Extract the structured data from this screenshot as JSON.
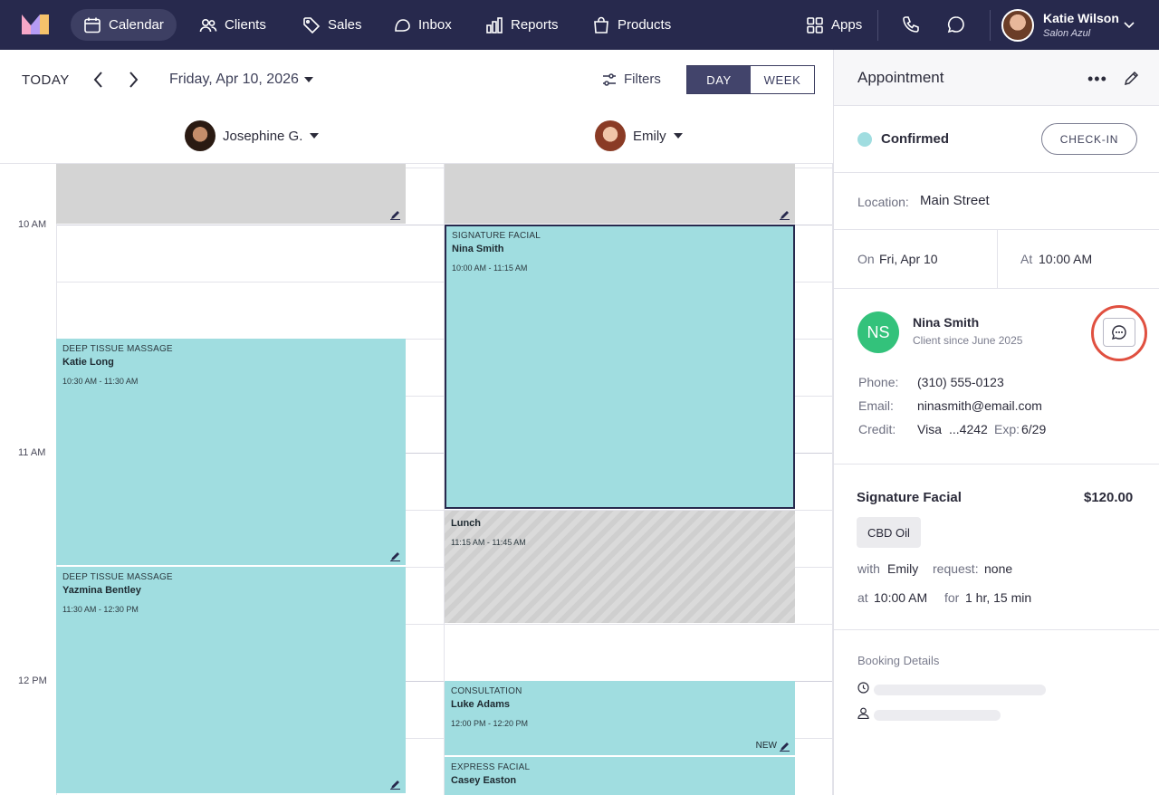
{
  "nav": {
    "items": [
      {
        "label": "Calendar",
        "icon": "calendar-icon",
        "active": true
      },
      {
        "label": "Clients",
        "icon": "users-icon"
      },
      {
        "label": "Sales",
        "icon": "tag-icon"
      },
      {
        "label": "Inbox",
        "icon": "inbox-icon"
      },
      {
        "label": "Reports",
        "icon": "bar-chart-icon"
      },
      {
        "label": "Products",
        "icon": "shopping-bag-icon"
      }
    ],
    "apps_label": "Apps",
    "user": {
      "name": "Katie Wilson",
      "org": "Salon Azul"
    }
  },
  "calendar": {
    "today_label": "TODAY",
    "date": "Friday, Apr 10, 2026",
    "filters_label": "Filters",
    "view": {
      "day": "DAY",
      "week": "WEEK",
      "selected": "day"
    },
    "staff": [
      {
        "name": "Josephine G."
      },
      {
        "name": "Emily"
      }
    ],
    "time_labels": [
      "10 AM",
      "11 AM",
      "12 PM"
    ],
    "appointments": [
      {
        "service": "DEEP TISSUE MASSAGE",
        "client": "Katie Long",
        "time": "10:30 AM - 11:30 AM"
      },
      {
        "service": "DEEP TISSUE MASSAGE",
        "client": "Yazmina Bentley",
        "time": "11:30 AM - 12:30 PM"
      },
      {
        "service": "SIGNATURE FACIAL",
        "client": "Nina Smith",
        "time": "10:00 AM - 11:15 AM"
      },
      {
        "service": "",
        "client": "Lunch",
        "time": "11:15 AM - 11:45 AM"
      },
      {
        "service": "CONSULTATION",
        "client": "Luke Adams",
        "time": "12:00 PM - 12:20 PM",
        "tag": "NEW"
      },
      {
        "service": "EXPRESS FACIAL",
        "client": "Casey Easton",
        "time": ""
      }
    ]
  },
  "panel": {
    "title": "Appointment",
    "more": "•••",
    "status": "Confirmed",
    "checkin_label": "CHECK-IN",
    "location_label": "Location:",
    "location": "Main Street",
    "on_label": "On",
    "on_value": "Fri, Apr 10",
    "at_label": "At",
    "at_value": "10:00 AM",
    "client": {
      "initials": "NS",
      "name": "Nina Smith",
      "since": "Client since June 2025",
      "phone_label": "Phone:",
      "phone": "(310) 555-0123",
      "email_label": "Email:",
      "email": "ninasmith@email.com",
      "credit_label": "Credit:",
      "card": "Visa",
      "last4": "...4242",
      "exp_label": "Exp:",
      "exp": "6/29"
    },
    "service": {
      "name": "Signature Facial",
      "price": "$120.00",
      "addon": "CBD Oil",
      "with_label": "with",
      "with_value": "Emily",
      "request_label": "request:",
      "request_value": "none",
      "at_label": "at",
      "at_value": "10:00 AM",
      "for_label": "for",
      "for_value": "1 hr, 15 min"
    },
    "booking_details_label": "Booking Details"
  }
}
